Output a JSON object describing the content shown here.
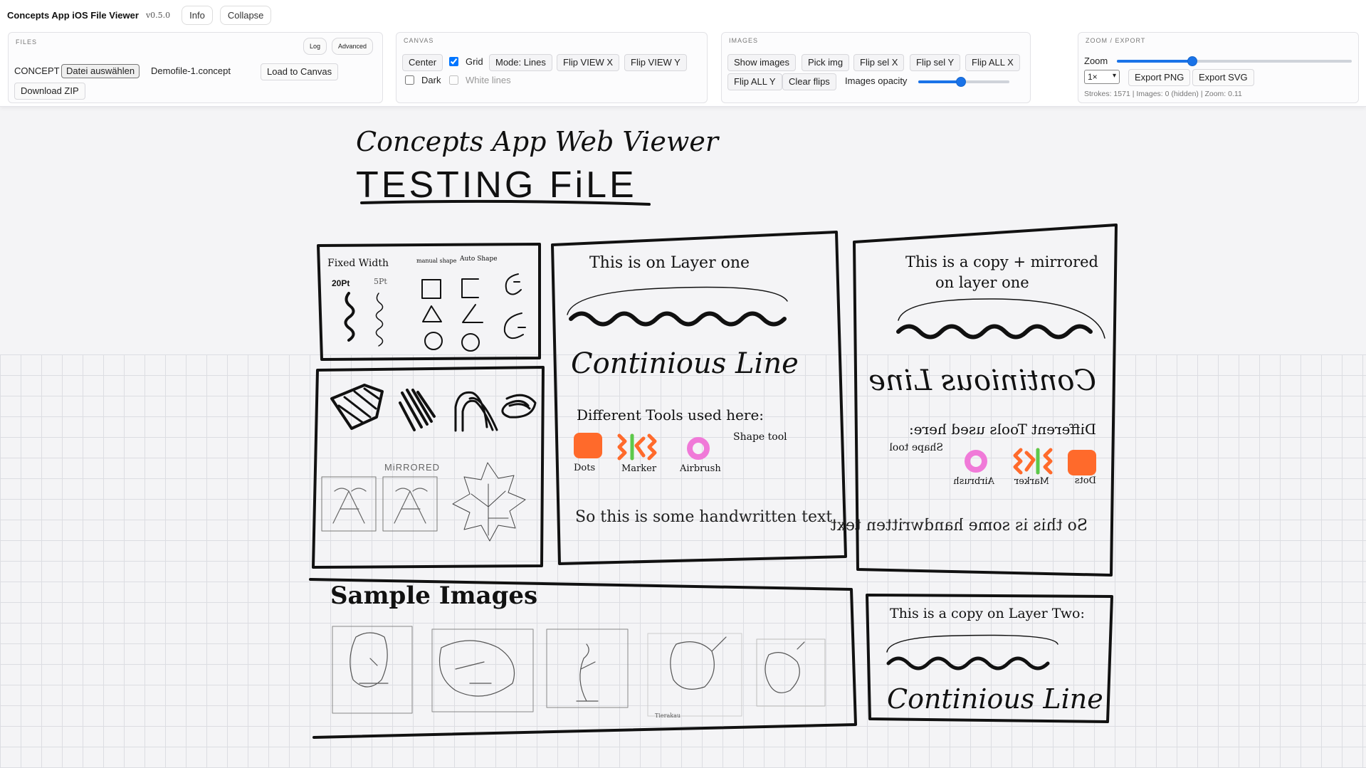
{
  "header": {
    "app_title": "Concepts App iOS File Viewer",
    "version": "v0.5.0",
    "info_label": "Info",
    "collapse_label": "Collapse"
  },
  "files": {
    "title": "FILES",
    "log_label": "Log",
    "advanced_label": "Advanced",
    "concept_label": "CONCEPT",
    "choose_file_label": "Datei auswählen",
    "file_name": "Demofile-1.concept",
    "load_label": "Load to Canvas",
    "download_label": "Download ZIP"
  },
  "canvas": {
    "title": "CANVAS",
    "center_label": "Center",
    "grid_label": "Grid",
    "grid_checked": true,
    "mode_label": "Mode: Lines",
    "flip_view_x_label": "Flip VIEW X",
    "flip_view_y_label": "Flip VIEW Y",
    "dark_label": "Dark",
    "dark_checked": false,
    "white_lines_label": "White lines",
    "white_lines_checked": false
  },
  "images": {
    "title": "IMAGES",
    "show_images_label": "Show images",
    "pick_img_label": "Pick img",
    "flip_sel_x_label": "Flip sel X",
    "flip_sel_y_label": "Flip sel Y",
    "flip_all_x_label": "Flip ALL X",
    "flip_all_y_label": "Flip ALL Y",
    "clear_flips_label": "Clear flips",
    "opacity_label": "Images opacity",
    "opacity_fraction": 0.47
  },
  "zoom_export": {
    "title": "ZOOM / EXPORT",
    "zoom_label": "Zoom",
    "zoom_fraction": 0.32,
    "scale_value": "1×",
    "export_png_label": "Export PNG",
    "export_svg_label": "Export SVG",
    "status": "Strokes: 1571 | Images: 0 (hidden) | Zoom: 0.11"
  },
  "drawing": {
    "title_line1": "Concepts App Web Viewer",
    "title_line2": "TESTING FiLE",
    "panel_tools": {
      "fixed_width": "Fixed Width",
      "pt20": "20Pt",
      "pt5": "5Pt",
      "manual_shape": "manual shape",
      "auto_shape": "Auto Shape"
    },
    "mirrored_label": "MiRRORED",
    "layer_one": {
      "heading": "This is on Layer one",
      "continuous": "Continious Line",
      "tools_heading": "Different Tools used here:",
      "shape_tool": "Shape tool",
      "dots": "Dots",
      "marker": "Marker",
      "airbrush": "Airbrush",
      "handwritten": "So this is some handwritten text"
    },
    "mirror_copy": {
      "heading_line1": "This is a copy + mirrored",
      "heading_line2": "on layer one",
      "continuous": "Continious Line",
      "tools_heading": "Different Tools used here:",
      "shape_tool": "Shape tool",
      "dots": "Dots",
      "marker": "Marker",
      "airbrush": "Airbrush",
      "handwritten": "So this is some handwritten text"
    },
    "sample_images": {
      "heading": "Sample Images",
      "caption": "Tierakau"
    },
    "layer_two": {
      "heading": "This is a copy on Layer Two:",
      "continuous": "Continious Line"
    },
    "colors": {
      "ink": "#111111",
      "orange": "#ff6a2b",
      "green": "#5cc94a",
      "pink": "#f07ad8",
      "accent": "#1a73e8"
    }
  }
}
